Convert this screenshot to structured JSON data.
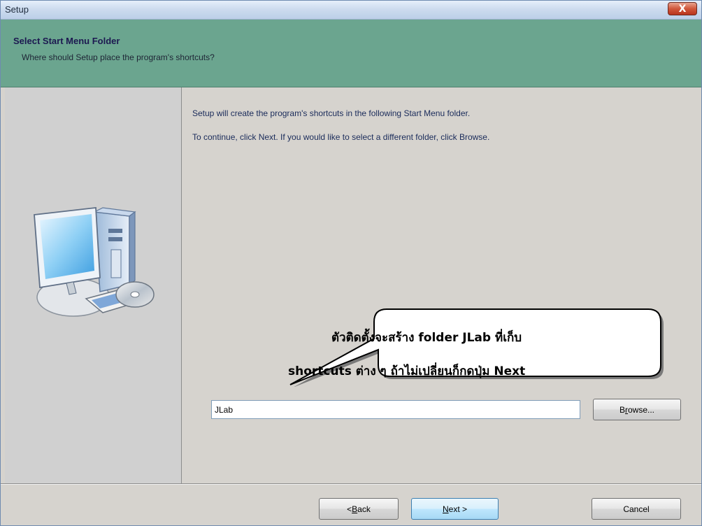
{
  "window": {
    "title": "Setup",
    "close_glyph": "X"
  },
  "header": {
    "title": "Select Start Menu Folder",
    "subtitle": "Where should Setup place the program's shortcuts?",
    "background_color": "#6ba58f"
  },
  "left_panel": {
    "icon": "computer-with-cd-icon"
  },
  "content": {
    "line1": "Setup will create the program's shortcuts in the following Start Menu folder.",
    "line2": "To continue, click Next. If you would like to select a different folder, click Browse.",
    "callout": {
      "line1": "ตัวติดตั้งจะสร้าง folder JLab ที่เก็บ",
      "line2": "shortcuts ต่าง ๆ  ถ้าไม่เปลี่ยนก็กดปุ่ม Next"
    },
    "folder_value": "JLab",
    "browse": {
      "pre": "B",
      "accel": "r",
      "post": "owse..."
    }
  },
  "footer": {
    "back": {
      "pre": "< ",
      "accel": "B",
      "post": "ack"
    },
    "next": {
      "pre": "",
      "accel": "N",
      "post": "ext >"
    },
    "cancel": "Cancel"
  }
}
